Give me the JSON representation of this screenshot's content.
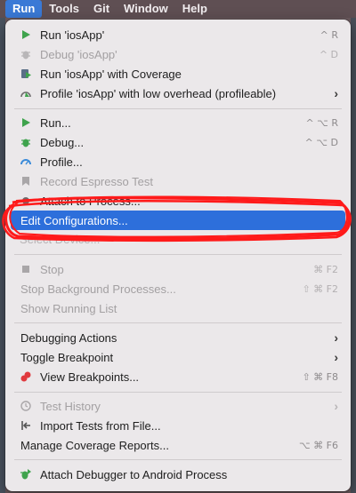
{
  "menubar": {
    "items": [
      {
        "label": "Run",
        "active": true
      },
      {
        "label": "Tools"
      },
      {
        "label": "Git"
      },
      {
        "label": "Window"
      },
      {
        "label": "Help"
      }
    ]
  },
  "menu": {
    "run_app": {
      "label": "Run 'iosApp'",
      "shortcut": "^ R",
      "icon": "run-icon"
    },
    "debug_app": {
      "label": "Debug 'iosApp'",
      "shortcut": "^ D",
      "icon": "debug-icon"
    },
    "run_coverage": {
      "label": "Run 'iosApp' with Coverage",
      "icon": "coverage-icon"
    },
    "profile_app": {
      "label": "Profile 'iosApp' with low overhead (profileable)",
      "icon": "profile-icon"
    },
    "run": {
      "label": "Run...",
      "shortcut": "^ ⌥ R",
      "icon": "run-icon"
    },
    "debug": {
      "label": "Debug...",
      "shortcut": "^ ⌥ D",
      "icon": "debug-icon"
    },
    "profile": {
      "label": "Profile...",
      "icon": "profile-gauge-icon"
    },
    "record_espresso": {
      "label": "Record Espresso Test",
      "icon": "record-icon"
    },
    "attach_to_process": {
      "label": "Attach to Process..."
    },
    "edit_configurations": {
      "label": "Edit Configurations..."
    },
    "ghost_text": "Select Device...",
    "stop": {
      "label": "Stop",
      "shortcut": "⌘ F2",
      "icon": "stop-icon"
    },
    "stop_background": {
      "label": "Stop Background Processes...",
      "shortcut": "⇧ ⌘ F2"
    },
    "show_running": {
      "label": "Show Running List"
    },
    "debugging_actions": {
      "label": "Debugging Actions"
    },
    "toggle_breakpoint": {
      "label": "Toggle Breakpoint"
    },
    "view_breakpoints": {
      "label": "View Breakpoints...",
      "shortcut": "⇧ ⌘ F8",
      "icon": "breakpoints-icon"
    },
    "test_history": {
      "label": "Test History",
      "icon": "history-icon"
    },
    "import_tests": {
      "label": "Import Tests from File...",
      "icon": "import-icon"
    },
    "manage_coverage": {
      "label": "Manage Coverage Reports...",
      "shortcut": "⌥ ⌘ F6"
    },
    "attach_debugger": {
      "label": "Attach Debugger to Android Process",
      "icon": "attach-debugger-icon"
    }
  },
  "colors": {
    "selection": "#2d6fdb",
    "annotation": "#ff1a1a",
    "run_green": "#3fa34d",
    "menu_bg": "#ebe8ea"
  }
}
